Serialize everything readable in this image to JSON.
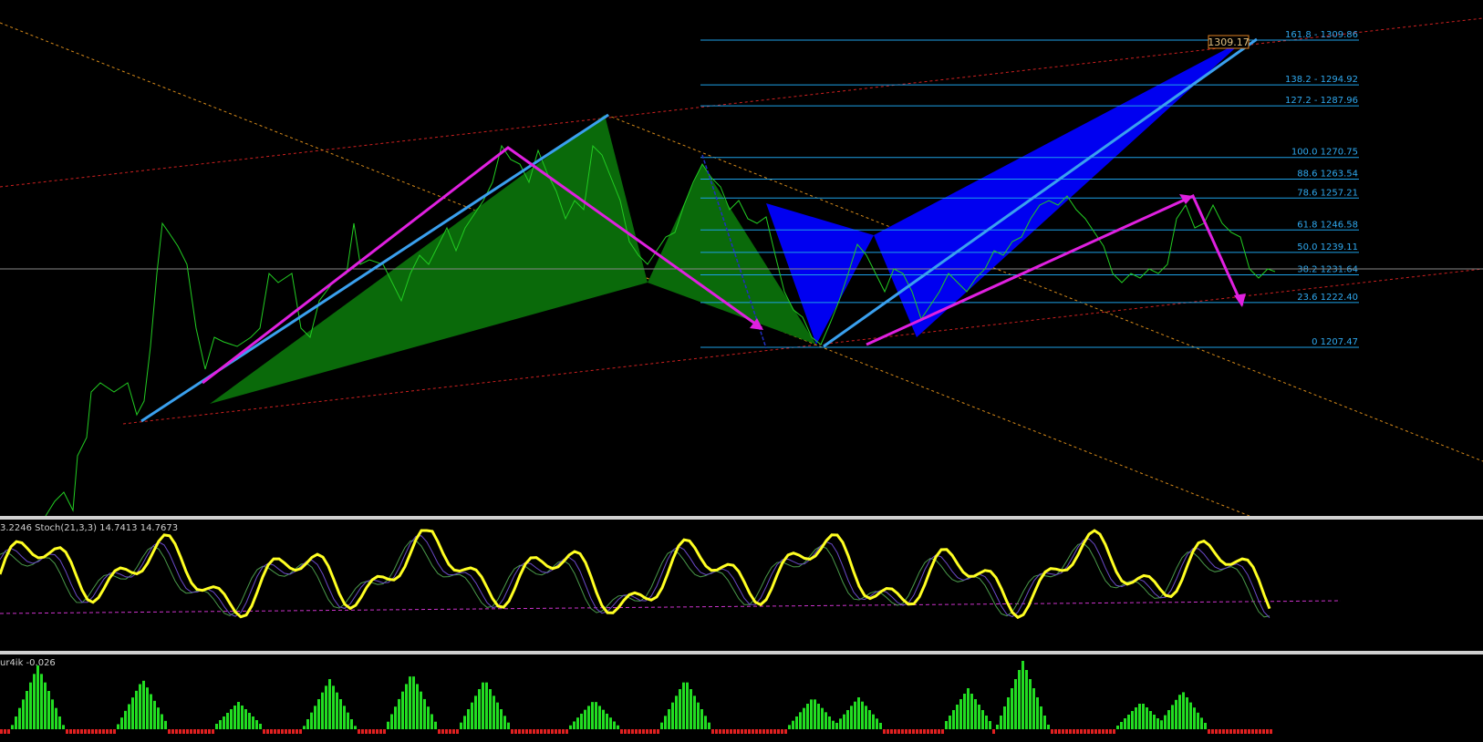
{
  "colors": {
    "background": "#000000",
    "price_line": "#22cc22",
    "fib_level": "#1ea0e6",
    "fib_label": "#2fa8ee",
    "pattern_green": "#0a6a0a",
    "pattern_blue": "#0000f0",
    "zigzag": "#e020e0",
    "trend_blue": "#3aa0ee",
    "channel_red": "#cc2020",
    "channel_orange": "#d68a1a",
    "stoch_main": "#ffff22",
    "stoch_signal": "#6a4ac8",
    "stoch_signal2": "#4a9a4a",
    "stoch_level": "#cc33cc",
    "hist_positive": "#22dd22",
    "hist_negative": "#e02020",
    "pane_separator": "#d0d0d0",
    "price_tag": "#e08020"
  },
  "main_pane": {
    "price_tag": "1309.17",
    "current_price_line": "1231.64"
  },
  "chart_data": [
    {
      "type": "line",
      "pane": "price",
      "x_unit": "bar index",
      "price_range": [
        1160,
        1320
      ],
      "series": [],
      "fib_levels": [
        {
          "ratio": "161.8",
          "price": 1309.86,
          "label": "161.8 - 1309.86"
        },
        {
          "ratio": "138.2",
          "price": 1294.92,
          "label": "138.2 - 1294.92"
        },
        {
          "ratio": "127.2",
          "price": 1287.96,
          "label": "127.2 - 1287.96"
        },
        {
          "ratio": "100.0",
          "price": 1270.75,
          "label": "100.0 1270.75"
        },
        {
          "ratio": "88.6",
          "price": 1263.54,
          "label": "88.6 1263.54"
        },
        {
          "ratio": "78.6",
          "price": 1257.21,
          "label": "78.6 1257.21"
        },
        {
          "ratio": "61.8",
          "price": 1246.58,
          "label": "61.8 1246.58"
        },
        {
          "ratio": "50.0",
          "price": 1239.11,
          "label": "50.0 1239.11"
        },
        {
          "ratio": "38.2",
          "price": 1231.64,
          "label": "38.2 1231.64"
        },
        {
          "ratio": "23.6",
          "price": 1222.4,
          "label": "23.6 1222.40"
        },
        {
          "ratio": "0",
          "price": 1207.47,
          "label": "0 1207.47"
        }
      ]
    },
    {
      "type": "line",
      "pane": "stochastic",
      "header": "3.2246  Stoch(21,3,3) 14.7413 14.7673",
      "ylim": [
        0,
        100
      ],
      "level": 20
    },
    {
      "type": "bar",
      "pane": "histogram",
      "header": "ur4ik -0.026",
      "last_value": -0.026
    }
  ]
}
